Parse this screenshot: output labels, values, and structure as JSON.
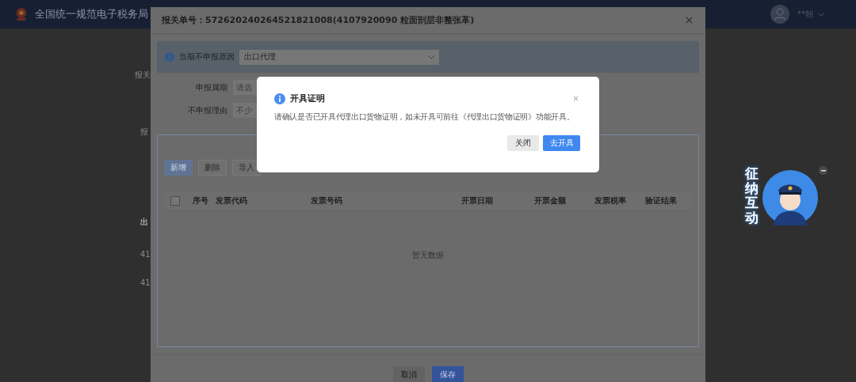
{
  "header": {
    "title": "全国统一规范电子税务局",
    "user": "**朝"
  },
  "background_fragments": [
    "报关",
    "报",
    "出",
    "41",
    "41"
  ],
  "form_dialog": {
    "title": "报关单号：572620240264521821008(4107920090 粒面剖层非整张革)",
    "reason": {
      "label": "当期不申报原因",
      "value": "出口代理"
    },
    "fields": [
      {
        "label": "申报属期",
        "placeholder": "请选"
      },
      {
        "label": "不申报理由",
        "placeholder": "不少"
      }
    ],
    "toolbar": [
      {
        "label": "新增",
        "kind": "primary"
      },
      {
        "label": "删除",
        "kind": "plain"
      },
      {
        "label": "导入",
        "kind": "plain"
      }
    ],
    "table": {
      "checked": false,
      "columns": [
        "序号",
        "发票代码",
        "发票号码",
        "开票日期",
        "开票金额",
        "发票税率",
        "验证结果"
      ],
      "empty_text": "暂无数据"
    },
    "buttons": [
      {
        "label": "取消",
        "kind": "plain"
      },
      {
        "label": "保存",
        "kind": "primary"
      }
    ]
  },
  "alert": {
    "title": "开具证明",
    "message": "请确认是否已开具代理出口货物证明，如未开具可前往《代理出口货物证明》功能开具。",
    "buttons": [
      {
        "label": "关闭",
        "kind": "plain"
      },
      {
        "label": "去开具",
        "kind": "primary"
      }
    ]
  },
  "widget": {
    "label": "征纳互动"
  }
}
